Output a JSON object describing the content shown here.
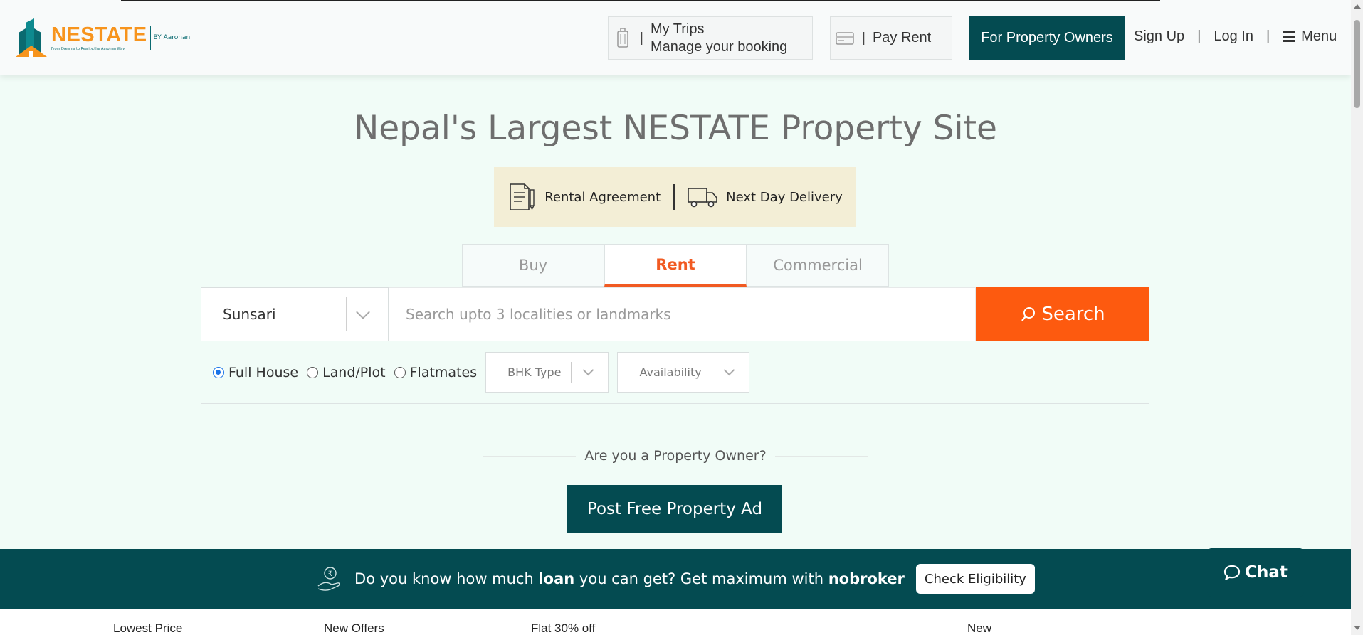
{
  "header": {
    "logo": {
      "name": "NESTATE",
      "by": "BY Aarohan",
      "tagline": "From Dreams to Reality,the Aarohan Way"
    },
    "my_trips": {
      "icon": "luggage-icon",
      "title": "My Trips",
      "subtitle": "Manage your booking"
    },
    "pay_rent": {
      "icon": "credit-card-icon",
      "label": "Pay Rent"
    },
    "separator": "|",
    "owners_label": "For Property Owners",
    "sign_up": "Sign Up",
    "log_in": "Log In",
    "menu": {
      "icon": "hamburger-icon",
      "label": "Menu"
    }
  },
  "hero": {
    "title": "Nepal's Largest NESTATE Property Site",
    "promo": [
      {
        "icon": "document-pen-icon",
        "label": "Rental Agreement"
      },
      {
        "icon": "truck-icon",
        "label": "Next Day Delivery"
      }
    ]
  },
  "search": {
    "tabs": [
      {
        "label": "Buy",
        "active": false
      },
      {
        "label": "Rent",
        "active": true
      },
      {
        "label": "Commercial",
        "active": false
      }
    ],
    "city": "Sunsari",
    "placeholder": "Search upto 3 localities or landmarks",
    "button_label": "Search",
    "property_types": [
      {
        "label": "Full House",
        "checked": true
      },
      {
        "label": "Land/Plot",
        "checked": false
      },
      {
        "label": "Flatmates",
        "checked": false
      }
    ],
    "bhk_placeholder": "BHK Type",
    "availability_placeholder": "Availability"
  },
  "owner": {
    "question": "Are you a Property Owner?",
    "post_button": "Post Free Property Ad"
  },
  "loan_banner": {
    "text_1": "Do you know how much",
    "bold_1": "loan",
    "text_2": "you can get? Get maximum with",
    "bold_2": "nobroker",
    "button": "Check Eligibility"
  },
  "chat": {
    "label": "Chat"
  },
  "bottom_tabs": [
    "Lowest Price",
    "New Offers",
    "Flat 30% off",
    "New"
  ],
  "colors": {
    "teal": "#044b51",
    "orange": "#fd5a0f",
    "page_bg": "#f1fcf7",
    "promo_bg": "#f3eed6",
    "logo_orange": "#f7941d"
  }
}
